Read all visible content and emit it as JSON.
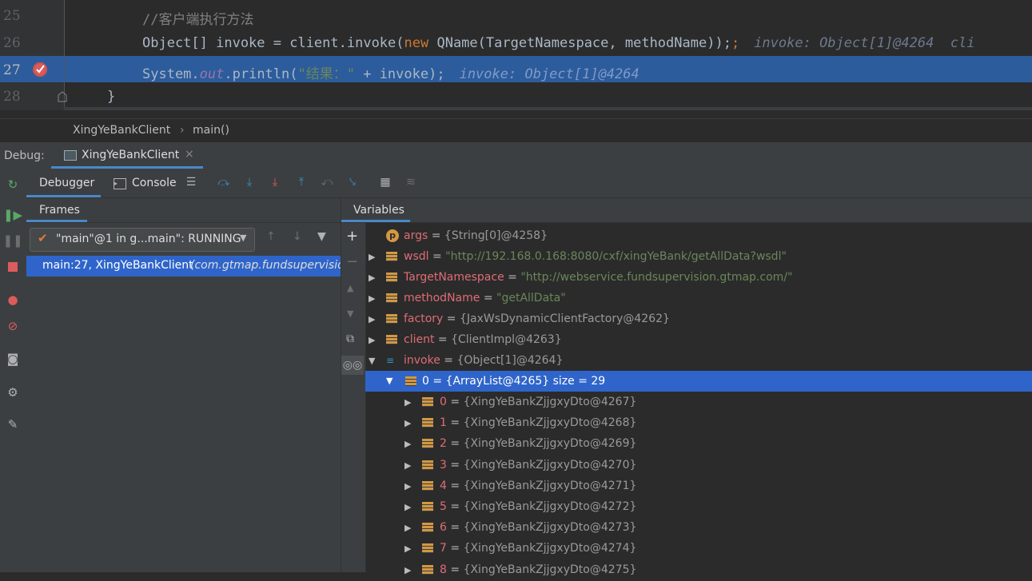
{
  "editor": {
    "lines": [
      {
        "num": "25",
        "indent": "        ",
        "code": "//客户端执行方法"
      },
      {
        "num": "26",
        "indent": "        ",
        "code_a": "Object[] invoke = client.invoke(",
        "kw": "new",
        "code_b": " QName(TargetNamespace, methodName));",
        "inline": "invoke: Object[1]@4264  cli"
      },
      {
        "num": "27",
        "indent": "        ",
        "code_a": "System.",
        "fld": "out",
        "code_b": ".println(",
        "str": "\"结果：\"",
        "code_c": " + invoke);",
        "inline": "invoke: Object[1]@4264"
      },
      {
        "num": "28",
        "indent": "    ",
        "code": "}"
      }
    ]
  },
  "breadcrumb": {
    "class": "XingYeBankClient",
    "method": "main()",
    "sep": "›"
  },
  "debug": {
    "label": "Debug:",
    "tab_title": "XingYeBankClient",
    "tab_close": "×",
    "subtabs": {
      "debugger": "Debugger",
      "console": "Console"
    },
    "frames_title": "Frames",
    "thread": "\"main\"@1 in g...main\": RUNNING",
    "frame": {
      "name": "main:27, XingYeBankClient",
      "pkg": "(com.gtmap.fundsupervision"
    },
    "variables_title": "Variables"
  },
  "variables": [
    {
      "kind": "p",
      "name": "args",
      "eq": " = ",
      "value": "{String[0]@4258}",
      "expand": false
    },
    {
      "kind": "f",
      "name": "wsdl",
      "eq": " = ",
      "str": "\"http://192.168.0.168:8080/cxf/xingYeBank/getAllData?wsdl\"",
      "expand": true
    },
    {
      "kind": "f",
      "name": "TargetNamespace",
      "eq": " = ",
      "str": "\"http://webservice.fundsupervision.gtmap.com/\"",
      "expand": true
    },
    {
      "kind": "f",
      "name": "methodName",
      "eq": " = ",
      "str": "\"getAllData\"",
      "expand": true
    },
    {
      "kind": "f",
      "name": "factory",
      "eq": " = ",
      "value": "{JaxWsDynamicClientFactory@4262}",
      "expand": true
    },
    {
      "kind": "f",
      "name": "client",
      "eq": " = ",
      "value": "{ClientImpl@4263}",
      "expand": true
    },
    {
      "kind": "a",
      "name": "invoke",
      "eq": " = ",
      "value": "{Object[1]@4264}",
      "expand": "open"
    }
  ],
  "selected": {
    "name": "0",
    "value": " = {ArrayList@4265}  size = 29"
  },
  "children": [
    {
      "name": "0",
      "value": "{XingYeBankZjjgxyDto@4267}"
    },
    {
      "name": "1",
      "value": "{XingYeBankZjjgxyDto@4268}"
    },
    {
      "name": "2",
      "value": "{XingYeBankZjjgxyDto@4269}"
    },
    {
      "name": "3",
      "value": "{XingYeBankZjjgxyDto@4270}"
    },
    {
      "name": "4",
      "value": "{XingYeBankZjjgxyDto@4271}"
    },
    {
      "name": "5",
      "value": "{XingYeBankZjjgxyDto@4272}"
    },
    {
      "name": "6",
      "value": "{XingYeBankZjjgxyDto@4273}"
    },
    {
      "name": "7",
      "value": "{XingYeBankZjjgxyDto@4274}"
    },
    {
      "name": "8",
      "value": "{XingYeBankZjjgxyDto@4275}"
    }
  ]
}
